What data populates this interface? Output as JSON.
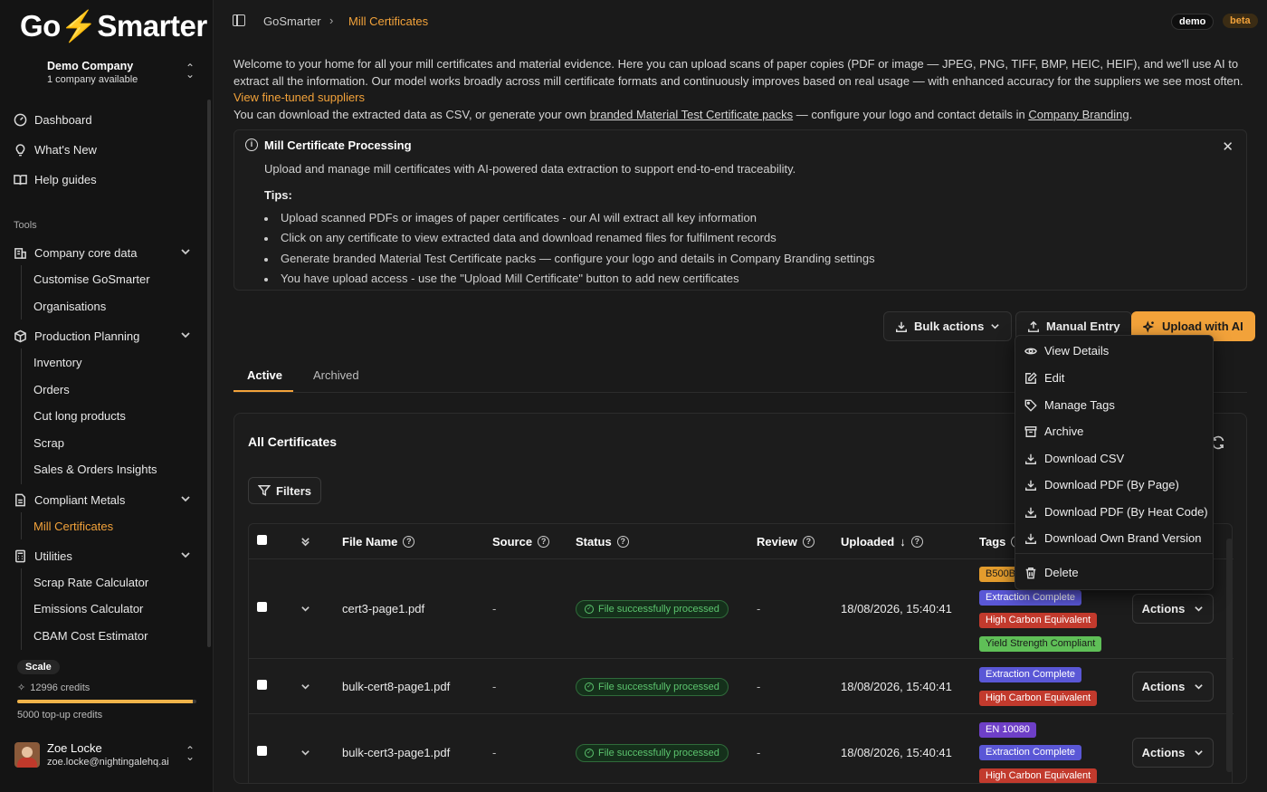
{
  "app": {
    "logo_text_left": "Go",
    "logo_bolt": "⚡",
    "logo_text_right": "Smarter"
  },
  "company": {
    "name": "Demo Company",
    "subtitle": "1 company available"
  },
  "nav": {
    "dashboard": "Dashboard",
    "whats_new": "What's New",
    "help_guides": "Help guides",
    "tools_label": "Tools",
    "company_core_data": "Company core data",
    "customise": "Customise GoSmarter",
    "organisations": "Organisations",
    "production_planning": "Production Planning",
    "inventory": "Inventory",
    "orders": "Orders",
    "cut_long": "Cut long products",
    "scrap": "Scrap",
    "sales_insights": "Sales & Orders Insights",
    "compliant_metals": "Compliant Metals",
    "mill_certificates": "Mill Certificates",
    "utilities": "Utilities",
    "scrap_rate": "Scrap Rate Calculator",
    "emissions": "Emissions Calculator",
    "cbam": "CBAM Cost Estimator"
  },
  "plan": {
    "name": "Scale",
    "credits": "12996 credits",
    "credits_fraction": 0.98,
    "topup": "5000 top-up credits"
  },
  "user": {
    "name": "Zoe Locke",
    "email": "zoe.locke@nightingalehq.ai"
  },
  "breadcrumb": {
    "root": "GoSmarter",
    "separator": "›",
    "current": "Mill Certificates"
  },
  "badges": {
    "demo": "demo",
    "beta": "beta"
  },
  "intro": {
    "p1": "Welcome to your home for all your mill certificates and material evidence. Here you can upload scans of paper copies (PDF or image — JPEG, PNG, TIFF, BMP, HEIC, HEIF), and we'll use AI to extract all the information. Our model works broadly across mill certificate formats and continuously improves based on real usage — with enhanced accuracy for the suppliers we see most often.",
    "p1_link": "View fine-tuned suppliers",
    "p2_a": "You can download the extracted data as CSV, or generate your own",
    "p2_link1": "branded Material Test Certificate packs",
    "p2_b": "— configure your logo and contact details in",
    "p2_link2": "Company Branding",
    "p2_c": "."
  },
  "info": {
    "title": "Mill Certificate Processing",
    "desc": "Upload and manage mill certificates with AI-powered data extraction to support end-to-end traceability.",
    "tips_label": "Tips:",
    "tips": [
      "Upload scanned PDFs or images of paper certificates - our AI will extract all key information",
      "Click on any certificate to view extracted data and download renamed files for fulfilment records",
      "Generate branded Material Test Certificate packs — configure your logo and details in Company Branding settings",
      "You have upload access - use the \"Upload Mill Certificate\" button to add new certificates"
    ]
  },
  "toolbar": {
    "bulk": "Bulk actions",
    "manual": "Manual Entry",
    "upload_ai": "Upload with AI"
  },
  "tabs": {
    "active": "Active",
    "archived": "Archived"
  },
  "card": {
    "title": "All Certificates",
    "filters": "Filters"
  },
  "table": {
    "headers": {
      "file_name": "File Name",
      "source": "Source",
      "status": "Status",
      "review": "Review",
      "uploaded": "Uploaded",
      "tags": "Tags"
    },
    "rows": [
      {
        "file": "cert3-page1.pdf",
        "source": "-",
        "status": "File successfully processed",
        "review": "-",
        "uploaded": "18/08/2026, 15:40:41",
        "tags": [
          "B500B",
          "Extraction Complete",
          "High Carbon Equivalent",
          "Yield Strength Compliant"
        ],
        "actions": "Actions"
      },
      {
        "file": "bulk-cert8-page1.pdf",
        "source": "-",
        "status": "File successfully processed",
        "review": "-",
        "uploaded": "18/08/2026, 15:40:41",
        "tags": [
          "Extraction Complete",
          "High Carbon Equivalent"
        ],
        "actions": "Actions"
      },
      {
        "file": "bulk-cert3-page1.pdf",
        "source": "-",
        "status": "File successfully processed",
        "review": "-",
        "uploaded": "18/08/2026, 15:40:41",
        "tags": [
          "EN 10080",
          "Extraction Complete",
          "High Carbon Equivalent"
        ],
        "actions": "Actions"
      }
    ]
  },
  "menu": {
    "view": "View Details",
    "edit": "Edit",
    "tags": "Manage Tags",
    "archive": "Archive",
    "csv": "Download CSV",
    "pdf_page": "Download PDF (By Page)",
    "pdf_heat": "Download PDF (By Heat Code)",
    "own_brand": "Download Own Brand Version",
    "delete": "Delete"
  },
  "colors": {
    "accent": "#f2a23a",
    "success": "#5cc46e",
    "tag_orange": "#e39c2d",
    "tag_blue": "#5a57d6",
    "tag_red": "#c23a2d",
    "tag_green": "#5fbf57",
    "tag_purple": "#6e3fc7"
  }
}
